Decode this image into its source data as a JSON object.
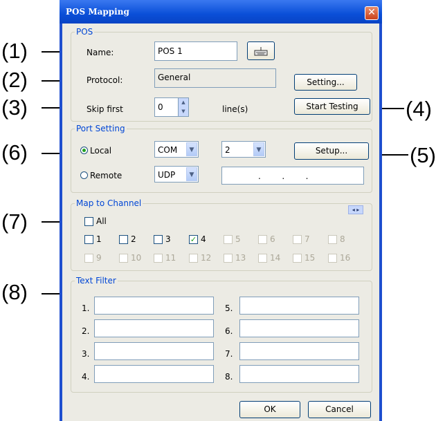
{
  "annotations": {
    "a1": "(1)",
    "a2": "(2)",
    "a3": "(3)",
    "a4": "(4)",
    "a5": "(5)",
    "a6": "(6)",
    "a7": "(7)",
    "a8": "(8)"
  },
  "window": {
    "title": "POS Mapping",
    "close_glyph": "✕"
  },
  "pos_group": {
    "legend": "POS",
    "name_label": "Name:",
    "name_value": "POS 1",
    "keyboard_icon": "keyboard-icon",
    "protocol_label": "Protocol:",
    "protocol_value": "General",
    "setting_button": "Setting...",
    "skip_label": "Skip  first",
    "skip_value": "0",
    "lines_label": "line(s)",
    "start_testing_button": "Start Testing"
  },
  "port_group": {
    "legend": "Port Setting",
    "local_label": "Local",
    "local_selected": true,
    "local_type": "COM",
    "local_port": "2",
    "setup_button": "Setup...",
    "remote_label": "Remote",
    "remote_type": "UDP",
    "remote_ip": ".        .        ."
  },
  "map_group": {
    "legend": "Map to Channel",
    "nav_glyph": "◂ ▸",
    "all_label": "All",
    "channels": [
      {
        "label": "1",
        "checked": false,
        "enabled": true
      },
      {
        "label": "2",
        "checked": false,
        "enabled": true
      },
      {
        "label": "3",
        "checked": false,
        "enabled": true
      },
      {
        "label": "4",
        "checked": true,
        "enabled": true
      },
      {
        "label": "5",
        "checked": false,
        "enabled": false
      },
      {
        "label": "6",
        "checked": false,
        "enabled": false
      },
      {
        "label": "7",
        "checked": false,
        "enabled": false
      },
      {
        "label": "8",
        "checked": false,
        "enabled": false
      },
      {
        "label": "9",
        "checked": false,
        "enabled": false
      },
      {
        "label": "10",
        "checked": false,
        "enabled": false
      },
      {
        "label": "11",
        "checked": false,
        "enabled": false
      },
      {
        "label": "12",
        "checked": false,
        "enabled": false
      },
      {
        "label": "13",
        "checked": false,
        "enabled": false
      },
      {
        "label": "14",
        "checked": false,
        "enabled": false
      },
      {
        "label": "15",
        "checked": false,
        "enabled": false
      },
      {
        "label": "16",
        "checked": false,
        "enabled": false
      }
    ]
  },
  "text_filter": {
    "legend": "Text Filter",
    "labels": [
      "1.",
      "2.",
      "3.",
      "4.",
      "5.",
      "6.",
      "7.",
      "8."
    ]
  },
  "footer": {
    "ok_button": "OK",
    "cancel_button": "Cancel"
  },
  "colors": {
    "title_blue": "#0a4fd8",
    "legend_blue": "#0046d5",
    "check_green": "#21a121",
    "disabled_gray": "#aca899"
  }
}
